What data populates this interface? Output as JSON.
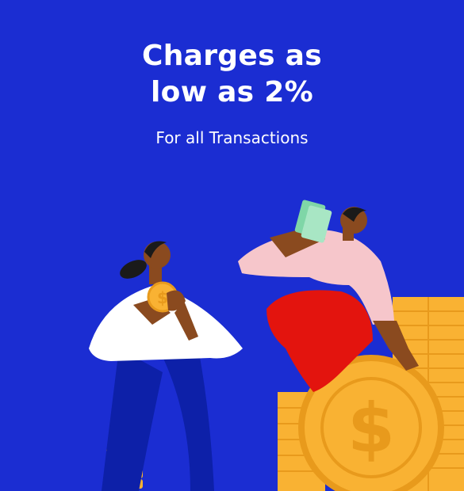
{
  "hero": {
    "title_line1": "Charges as",
    "title_line2": "low as 2%",
    "subtitle": "For all Transactions"
  },
  "illustration": {
    "subject": "two-people-with-coins",
    "icons": [
      "dollar-coin-icon",
      "cash-note-icon",
      "coin-stack-icon"
    ]
  },
  "colors": {
    "background": "#1B2DD2",
    "text": "#FFFFFF",
    "coin": "#F9B233",
    "coin_dark": "#E89A1C",
    "skin": "#8A4A1F",
    "shirt_white": "#FFFFFF",
    "shirt_pink": "#F6C6CB",
    "pants_blue": "#0D20A8",
    "pants_red": "#E3140E",
    "cash_green": "#7FD6A7"
  }
}
